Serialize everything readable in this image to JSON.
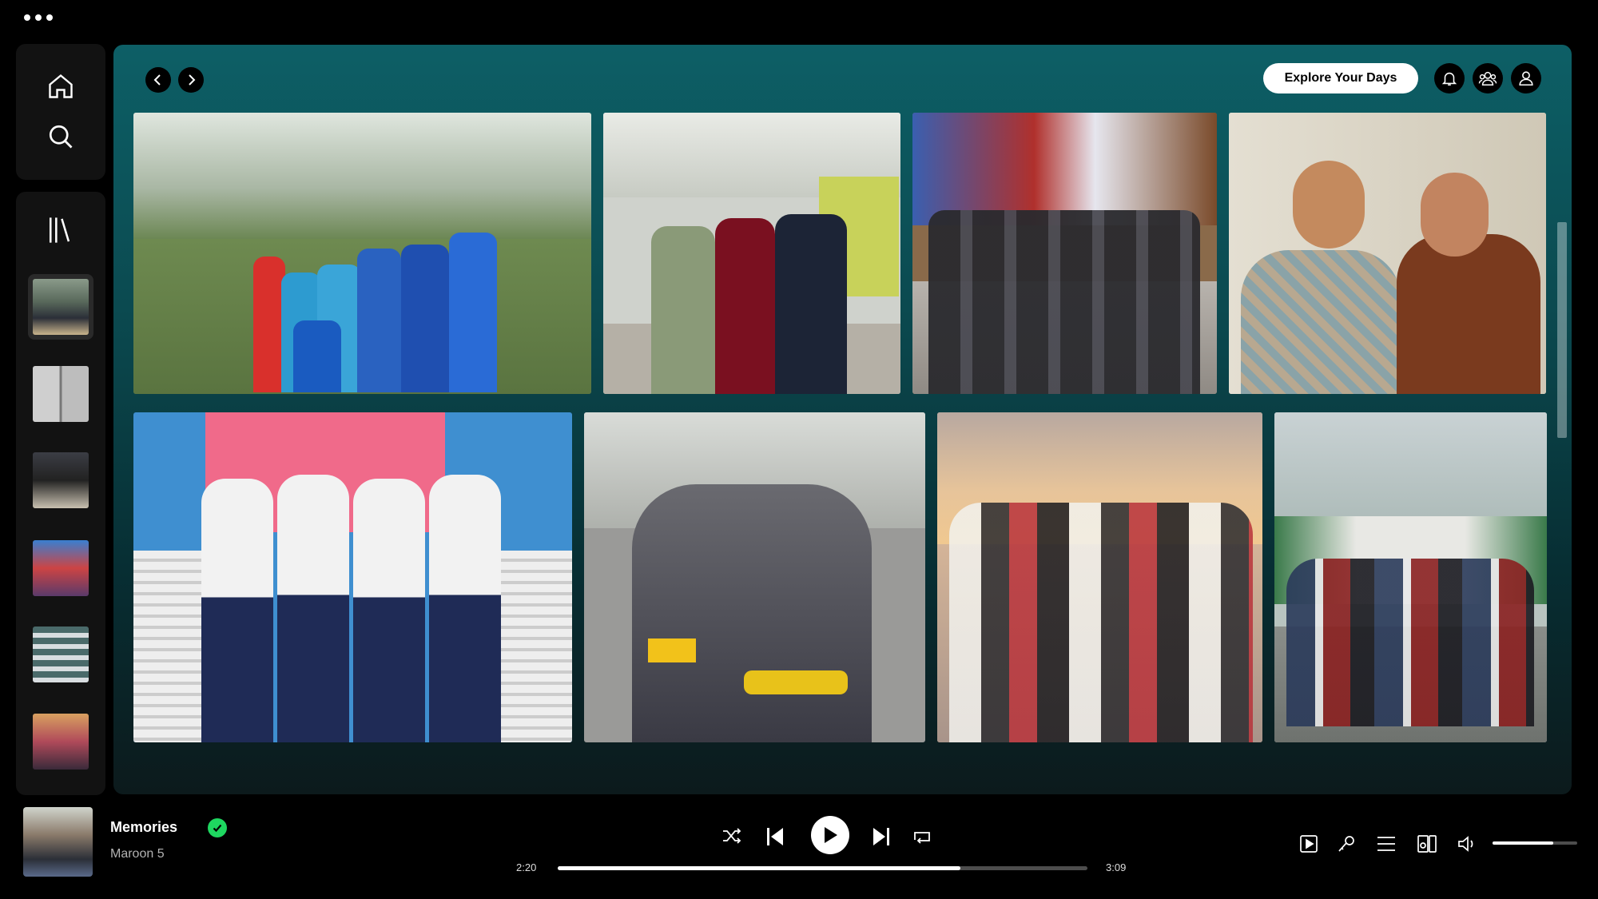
{
  "header": {
    "explore_label": "Explore Your Days"
  },
  "icons": {
    "window_menu": "more-dots-icon",
    "home": "home-icon",
    "search": "search-icon",
    "library": "library-icon",
    "back": "chevron-left-icon",
    "forward": "chevron-right-icon",
    "notifications": "bell-icon",
    "friends": "friends-icon",
    "profile": "user-icon"
  },
  "library": {
    "items": [
      {
        "name": "memories-playlist",
        "active": true
      },
      {
        "name": "portraits-playlist",
        "active": false
      },
      {
        "name": "group-playlist",
        "active": false
      },
      {
        "name": "event-playlist",
        "active": false
      },
      {
        "name": "class-photo-playlist",
        "active": false
      },
      {
        "name": "family-playlist",
        "active": false
      }
    ]
  },
  "photos": [
    "group-in-park",
    "three-men-in-hallway",
    "girls-with-luggage",
    "two-boys-selfie",
    "school-captains",
    "girls-on-stairs",
    "girls-by-lake-sunset",
    "boys-celebrating"
  ],
  "player": {
    "title": "Memories",
    "artist": "Maroon 5",
    "elapsed": "2:20",
    "duration": "3:09",
    "progress": 0.76,
    "volume": 0.72
  },
  "colors": {
    "accent": "#1ed760",
    "panel_top": "#0d5f66",
    "panel_bottom": "#0c1a1c"
  }
}
